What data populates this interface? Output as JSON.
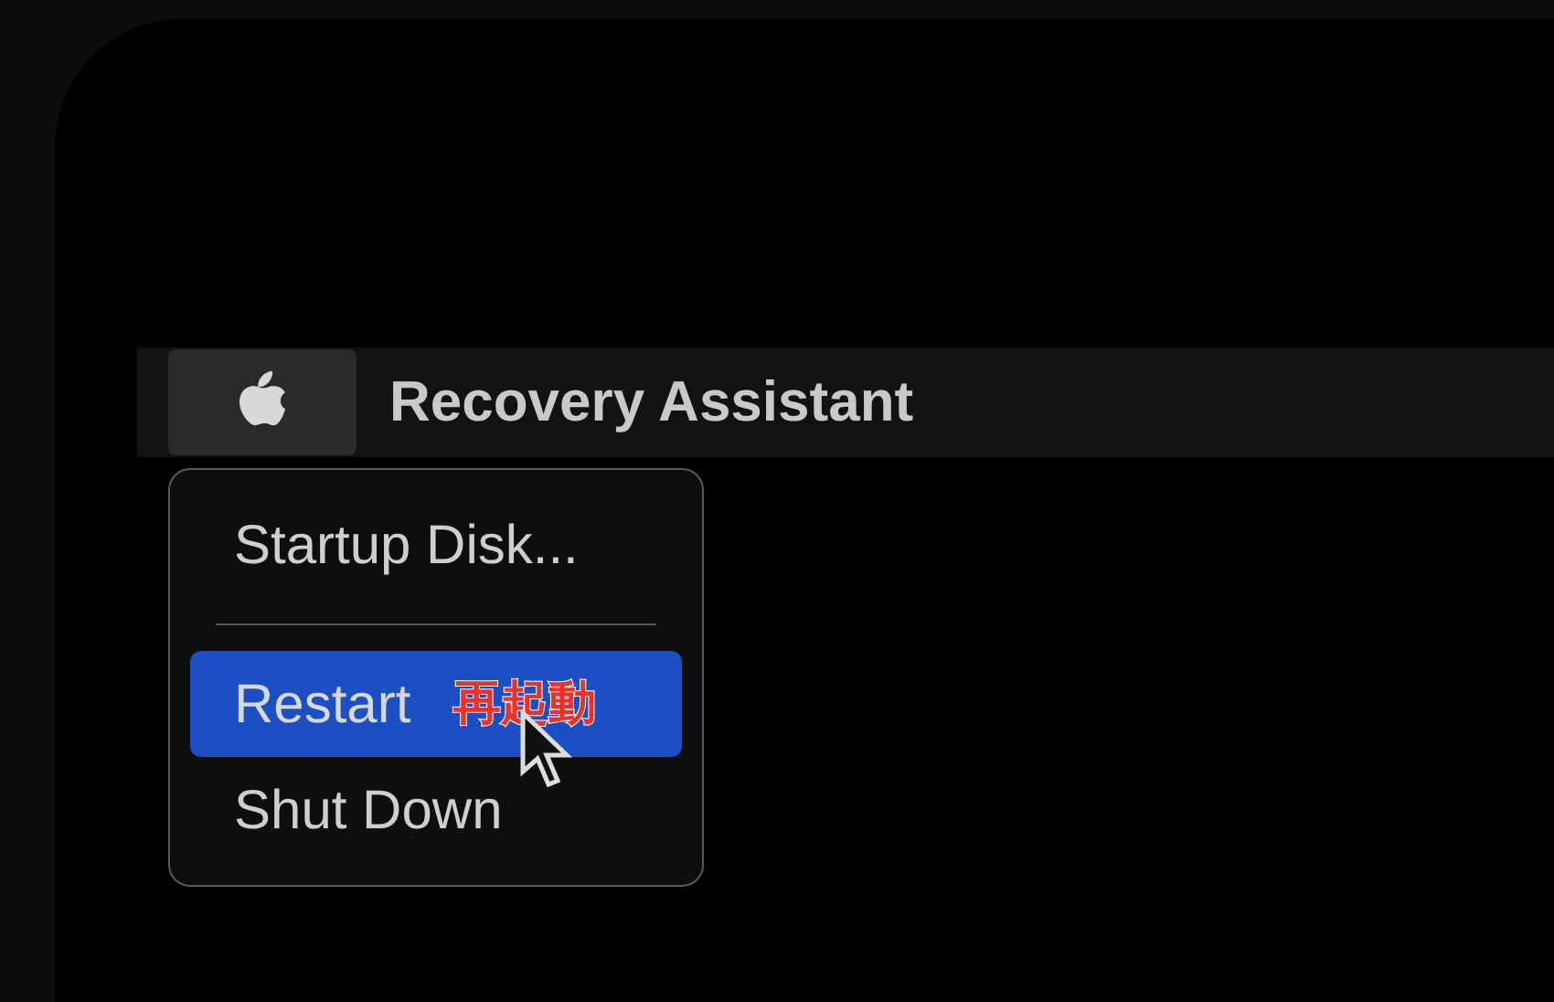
{
  "menu_bar": {
    "title": "Recovery Assistant"
  },
  "menu": {
    "items": [
      {
        "kind": "item",
        "label": "Startup Disk...",
        "selected": false
      },
      {
        "kind": "separator"
      },
      {
        "kind": "item",
        "label": "Restart",
        "selected": true
      },
      {
        "kind": "item",
        "label": "Shut Down",
        "selected": false
      }
    ]
  },
  "annotation": {
    "text": "再起動"
  }
}
